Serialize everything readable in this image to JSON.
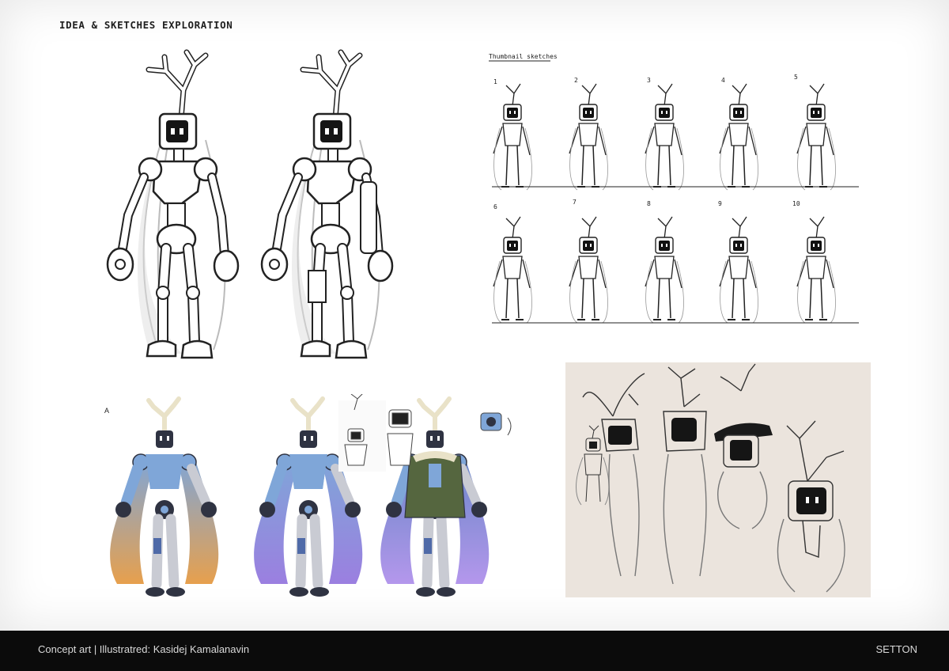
{
  "page": {
    "title": "IDEA & SKETCHES EXPLORATION"
  },
  "thumbnails": {
    "label": "Thumbnail sketches",
    "numbers": [
      "1",
      "2",
      "3",
      "4",
      "5",
      "6",
      "7",
      "8",
      "9",
      "10"
    ]
  },
  "color_set": {
    "label": "A",
    "palette": {
      "body_blue": "#7fa6d8",
      "dark": "#2f3342",
      "cream": "#e9e2c8",
      "orange": "#e7a04d",
      "purple": "#9b7fe0",
      "green_coat": "#55663f",
      "limb_grey": "#c9cbd3"
    }
  },
  "sketch_board": {
    "background": "#ebe4dd"
  },
  "footer": {
    "credit": "Concept art | Illustratred: Kasidej Kamalanavin",
    "brand": "SETTON"
  }
}
